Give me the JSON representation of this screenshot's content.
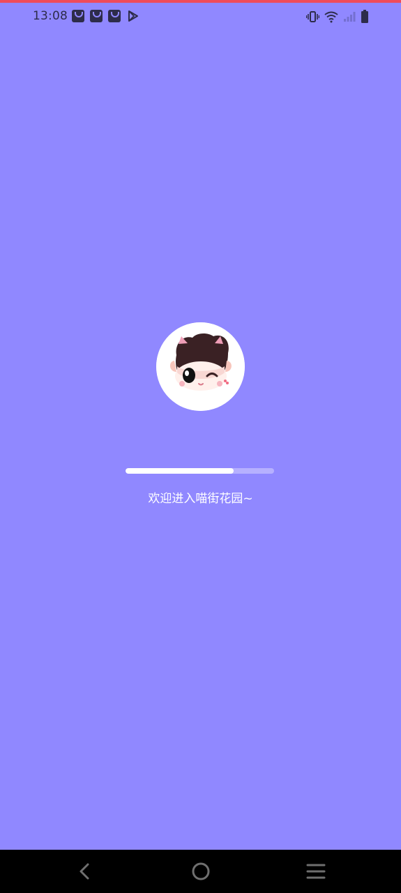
{
  "status_bar": {
    "time": "13:08",
    "left_icons": [
      "shopping-bag-icon",
      "shopping-bag-icon",
      "shopping-bag-icon",
      "play-store-icon"
    ],
    "right_icons": [
      "vibrate-icon",
      "wifi-icon",
      "signal-icon",
      "battery-icon"
    ]
  },
  "splash": {
    "avatar": "cartoon-girl-avatar",
    "progress": 0.73,
    "welcome_text": "欢迎进入喵街花园~"
  },
  "navigation_bar": {
    "buttons": [
      "back-icon",
      "home-icon",
      "menu-icon"
    ]
  },
  "colors": {
    "background": "#9088ff",
    "accent_top": "#ef4b5b",
    "nav_background": "#000000",
    "progress_fill": "#ffffff",
    "text": "#ffffff"
  }
}
